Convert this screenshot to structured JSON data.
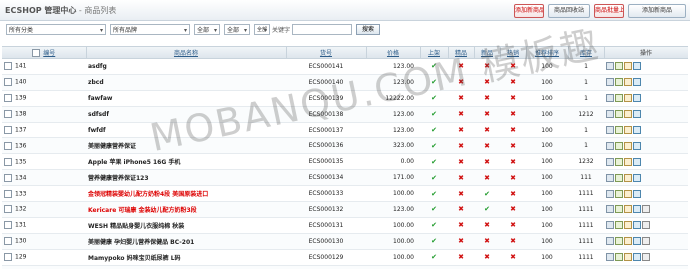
{
  "header": {
    "title": "ECSHOP 管理中心",
    "subtitle": " - 商品列表",
    "buttons": [
      "添加新商品",
      "商品回收站",
      "商品批量上传",
      "添加新商品"
    ]
  },
  "filter": {
    "category": "所有分类",
    "brand": "所有品牌",
    "select3": "全部",
    "select4": "全部",
    "select5": "全部",
    "keyword_label": "关键字",
    "keyword_value": "",
    "search_button": "搜索"
  },
  "table": {
    "columns": [
      "编号",
      "商品名称",
      "货号",
      "价格",
      "上架",
      "精品",
      "新品",
      "热销",
      "推荐排序",
      "库存",
      "操作"
    ],
    "rows": [
      {
        "id": "141",
        "name": "asdfg",
        "sku": "ECS000141",
        "price": "123.00",
        "onsale": true,
        "best": false,
        "new": false,
        "hot": false,
        "sort": "100",
        "stock": "1",
        "red": false
      },
      {
        "id": "140",
        "name": "zbcd",
        "sku": "ECS000140",
        "price": "123.00",
        "onsale": true,
        "best": false,
        "new": false,
        "hot": false,
        "sort": "100",
        "stock": "1",
        "red": false
      },
      {
        "id": "139",
        "name": "fawfaw",
        "sku": "ECS000139",
        "price": "12222.00",
        "onsale": true,
        "best": false,
        "new": false,
        "hot": false,
        "sort": "100",
        "stock": "1",
        "red": false
      },
      {
        "id": "138",
        "name": "sdfsdf",
        "sku": "ECS000138",
        "price": "123.00",
        "onsale": true,
        "best": false,
        "new": false,
        "hot": false,
        "sort": "100",
        "stock": "1212",
        "red": false
      },
      {
        "id": "137",
        "name": "fwfdf",
        "sku": "ECS000137",
        "price": "123.00",
        "onsale": true,
        "best": false,
        "new": false,
        "hot": false,
        "sort": "100",
        "stock": "1",
        "red": false
      },
      {
        "id": "136",
        "name": "美丽健康营养保证",
        "sku": "ECS000136",
        "price": "323.00",
        "onsale": true,
        "best": false,
        "new": false,
        "hot": false,
        "sort": "100",
        "stock": "1",
        "red": false
      },
      {
        "id": "135",
        "name": "Apple 苹果 iPhone5 16G 手机",
        "sku": "ECS000135",
        "price": "0.00",
        "onsale": true,
        "best": false,
        "new": false,
        "hot": false,
        "sort": "100",
        "stock": "1232",
        "red": false
      },
      {
        "id": "134",
        "name": "营养健康营养保证123",
        "sku": "ECS000134",
        "price": "171.00",
        "onsale": true,
        "best": false,
        "new": false,
        "hot": false,
        "sort": "100",
        "stock": "111",
        "red": false
      },
      {
        "id": "133",
        "name": "金领冠精装婴幼儿配方奶粉4段 美国原装进口",
        "sku": "ECS000133",
        "price": "100.00",
        "onsale": true,
        "best": false,
        "new": true,
        "hot": false,
        "sort": "100",
        "stock": "1111",
        "red": true
      },
      {
        "id": "132",
        "name": "Kericare 可瑞康 金装幼儿配方奶粉3段",
        "sku": "ECS000132",
        "price": "123.00",
        "onsale": true,
        "best": false,
        "new": true,
        "hot": false,
        "sort": "100",
        "stock": "1111",
        "red": true
      },
      {
        "id": "131",
        "name": "WESH 精品贴身婴儿衣服纯棉 秋装",
        "sku": "ECS000131",
        "price": "100.00",
        "onsale": true,
        "best": false,
        "new": false,
        "hot": false,
        "sort": "100",
        "stock": "1111",
        "red": false
      },
      {
        "id": "130",
        "name": "美丽健康 孕妇婴儿营养保健品 BC-201",
        "sku": "ECS000130",
        "price": "100.00",
        "onsale": true,
        "best": false,
        "new": false,
        "hot": false,
        "sort": "100",
        "stock": "1111",
        "red": false
      },
      {
        "id": "129",
        "name": "Mamypoko 妈咪宝贝纸尿裤 L码",
        "sku": "ECS000129",
        "price": "100.00",
        "onsale": true,
        "best": false,
        "new": false,
        "hot": false,
        "sort": "100",
        "stock": "1111",
        "red": false
      },
      {
        "id": "128",
        "name": "贝亲 奶瓶清洗剂 婴儿用品 NY-213",
        "sku": "ECS000128",
        "price": "100.00",
        "onsale": true,
        "best": false,
        "new": false,
        "hot": false,
        "sort": "100",
        "stock": "1111",
        "red": false
      }
    ]
  },
  "watermark": "MOBANQU.COM 模板趣",
  "colors": {
    "accent": "#2d5d8a",
    "yes": "#1e9a2a",
    "no": "#d01010",
    "red_name": "#d00000"
  }
}
